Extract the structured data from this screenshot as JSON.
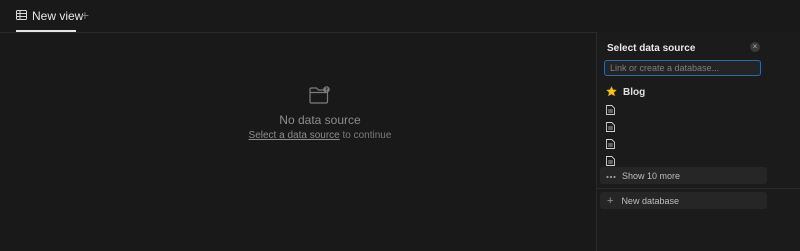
{
  "tabs": {
    "active_label": "New view",
    "add_symbol": "+"
  },
  "empty_state": {
    "title": "No data source",
    "link_text": "Select a data source",
    "suffix_text": " to continue"
  },
  "panel": {
    "title": "Select data source",
    "close_symbol": "×",
    "search_placeholder": "Link or create a database...",
    "items": [
      {
        "icon": "star-icon",
        "label": "Blog"
      },
      {
        "icon": "document-icon",
        "label": ""
      },
      {
        "icon": "document-icon",
        "label": ""
      },
      {
        "icon": "document-icon",
        "label": ""
      },
      {
        "icon": "document-icon",
        "label": ""
      }
    ],
    "show_more_label": "Show 10 more",
    "new_database_label": "New database",
    "new_database_symbol": "+"
  },
  "colors": {
    "background": "#191919",
    "focus_border": "#2e6aa8",
    "star": "#f5c518"
  }
}
